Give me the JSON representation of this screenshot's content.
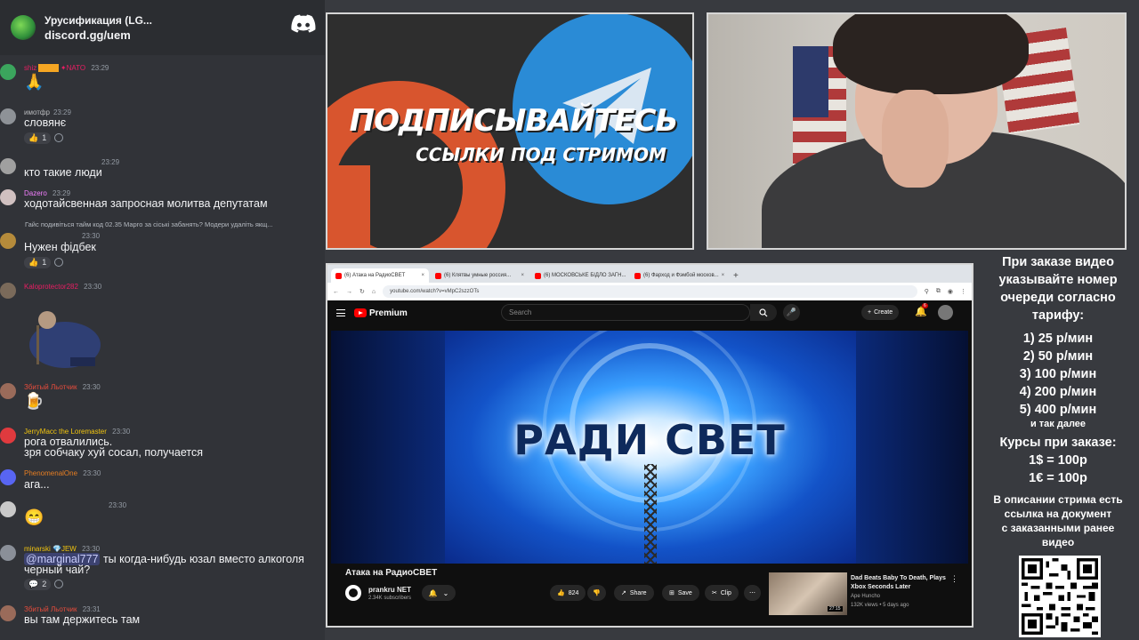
{
  "discord": {
    "server_name": "Урусификация (LG...",
    "invite": "discord.gg/uem",
    "messages": [
      {
        "user": "shiz",
        "badge": "NATO",
        "time": "23:29",
        "emoji": "🙏",
        "color": "#e91e63"
      },
      {
        "user": "имотфр",
        "time": "23:29",
        "text": "словянє",
        "reaction": "1",
        "color": "#b9bbbe"
      },
      {
        "user": "",
        "time": "23:29",
        "text": "кто такие люди",
        "color": "#b9bbbe"
      },
      {
        "user": "Dazero",
        "time": "23:29",
        "text": "ходотайсвенная запросная молитва депутатам",
        "color": "#f47fff"
      },
      {
        "reply": "Гайс подивіться тайм код 02.35 Марго за сіські забанять? Модери удаліть якщ...",
        "time": "23:30",
        "text": "Нужен фідбек",
        "reaction": "1",
        "color": "#b9bbbe"
      },
      {
        "user": "Kaloprotector282",
        "time": "23:30",
        "color": "#e91e63"
      },
      {
        "user": "Збитый Льотчик",
        "time": "23:30",
        "emoji": "🍺",
        "color": "#e74c3c"
      },
      {
        "user": "JerryMacc the Loremaster",
        "time": "23:30",
        "text": "рога отвалились.",
        "text2": "зря собчаку хуй сосал, получается",
        "color": "#f1c40f"
      },
      {
        "user": "PhenomenalOne",
        "time": "23:30",
        "text": "ага...",
        "color": "#e67e22"
      },
      {
        "user": "",
        "time": "23:30",
        "emoji": "😁",
        "color": "#b9bbbe"
      },
      {
        "user": "minarski",
        "badge": "JEW",
        "time": "23:30",
        "mention": "@marginal777",
        "text": " ты когда-нибудь юзал вместо алкоголя",
        "text2": "черный чай?",
        "reaction": "2",
        "color": "#f1c40f"
      },
      {
        "user": "Збитый Льотчик",
        "time": "23:31",
        "text": "вы там держитесь там",
        "color": "#e74c3c"
      }
    ]
  },
  "promo": {
    "title": "ПОДПИСЫВАЙТЕСЬ",
    "subtitle": "ССЫЛКИ ПОД СТРИМОМ"
  },
  "browser": {
    "tabs": [
      "(6) Атака на РадиоСВЕТ",
      "(6) Клятвы умные россия...",
      "(6) МОСКОВСЬКЕ БІДЛО ЗАГН...",
      "(6) Фарход и Фэмбой москов..."
    ],
    "url": "youtube.com/watch?v=vMpC2szzOTs",
    "youtube": {
      "logo": "Premium",
      "search_placeholder": "Search",
      "create_label": "Create",
      "notifications": "6",
      "video_title": "Атака на РадиоСВЕТ",
      "channel": "prankru NET",
      "subscribers": "2.34K subscribers",
      "likes": "824",
      "share": "Share",
      "save": "Save",
      "clip": "Clip",
      "player_text": "РАДИ СВЕТ",
      "recommended": {
        "title": "Dad Beats Baby To Death, Plays Xbox Seconds Later",
        "channel": "Ape Huncho",
        "meta": "132K views • 5 days ago",
        "duration": "27:15"
      }
    }
  },
  "info": {
    "line1": "При заказе видео",
    "line2": "указывайте номер",
    "line3": "очереди согласно",
    "line4": "тарифу:",
    "tariffs": [
      "1) 25 р/мин",
      "2) 50 р/мин",
      "3) 100 р/мин",
      "4) 200 р/мин",
      "5) 400 р/мин"
    ],
    "etc": "и так далее",
    "rates_title": "Курсы при заказе:",
    "rate1": "1$ = 100р",
    "rate2": "1€ = 100р",
    "desc1": "В описании стрима есть",
    "desc2": "ссылка на документ",
    "desc3": "с заказанными ранее",
    "desc4": "видео"
  }
}
